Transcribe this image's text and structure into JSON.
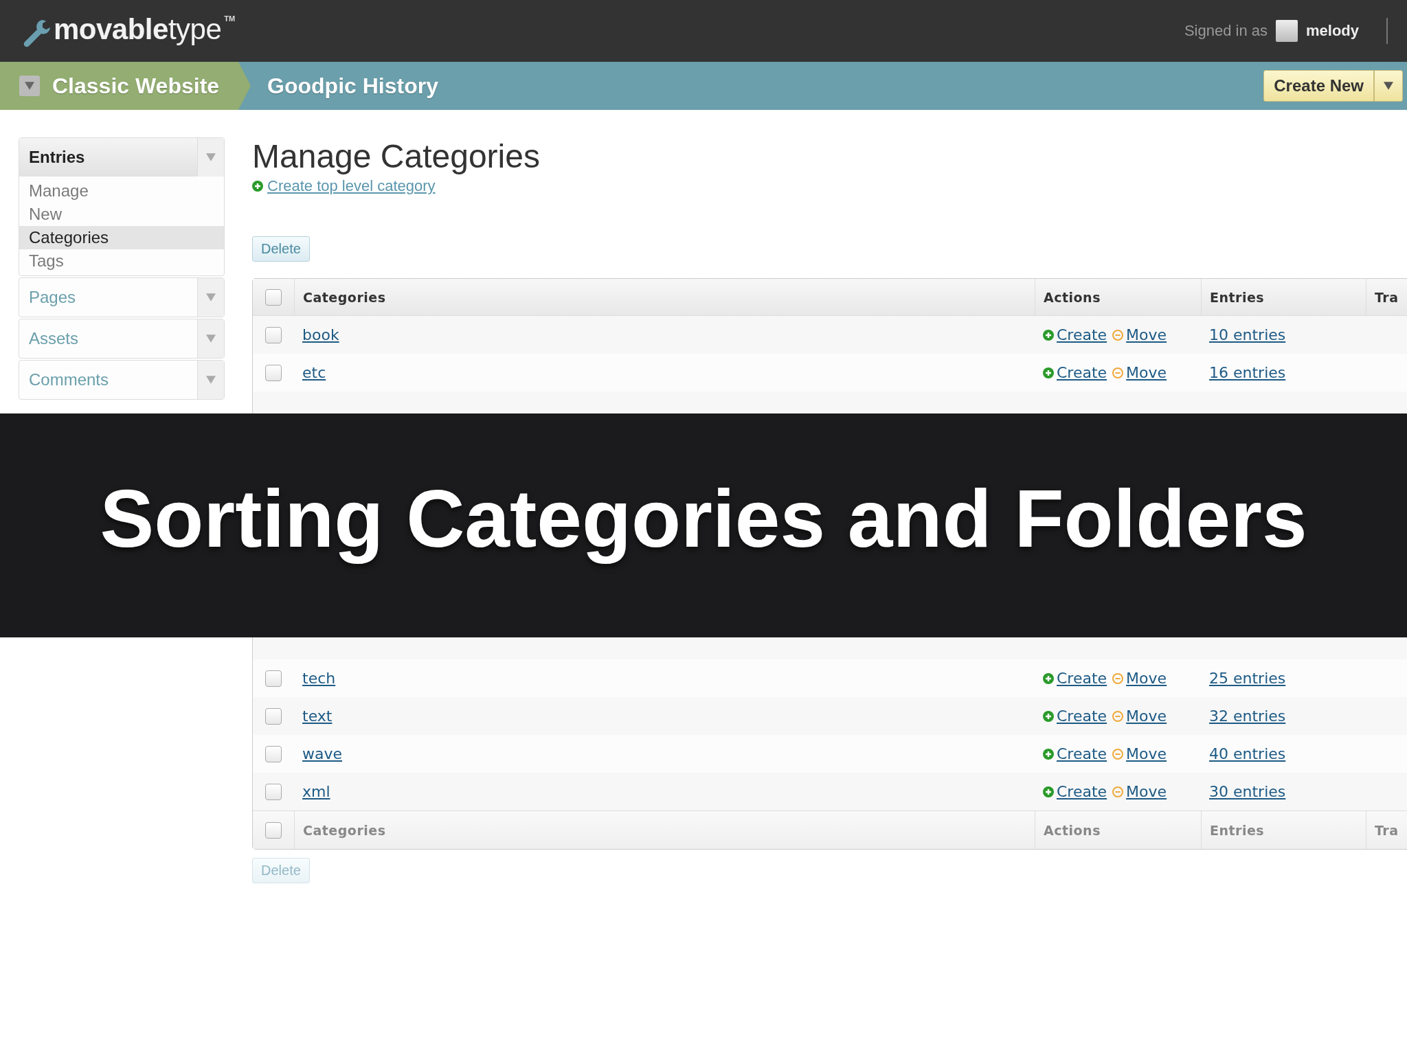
{
  "topbar": {
    "logo": "**movable**type",
    "trademark": "TM",
    "signed_in_label": "Signed in as",
    "user": "melody"
  },
  "navbar": {
    "website": "Classic Website",
    "blog": "Goodpic History",
    "create_button": "Create New"
  },
  "sidebar": {
    "menus": [
      {
        "label": "Entries",
        "expanded": true,
        "items": [
          {
            "label": "Manage",
            "selected": false
          },
          {
            "label": "New",
            "selected": false
          },
          {
            "label": "Categories",
            "selected": true
          },
          {
            "label": "Tags",
            "selected": false
          }
        ]
      },
      {
        "label": "Pages",
        "expanded": false
      },
      {
        "label": "Assets",
        "expanded": false
      },
      {
        "label": "Comments",
        "expanded": false
      }
    ]
  },
  "main": {
    "title": "Manage Categories",
    "create_link": "Create top level category",
    "delete_button": "Delete"
  },
  "table": {
    "select_all": {
      "checked": false
    },
    "columns": [
      "Categories",
      "Actions",
      "Entries",
      "Tra"
    ],
    "rows": [
      {
        "name": "book",
        "create": "Create",
        "move": "Move",
        "entries": "10 entries",
        "checked": false
      },
      {
        "name": "etc",
        "create": "Create",
        "move": "Move",
        "entries": "16 entries",
        "checked": false
      }
    ]
  },
  "banner": {
    "title": "Sorting Categories and Folders"
  },
  "table_continued": {
    "rows": [
      {
        "name": "tech",
        "create": "Create",
        "move": "Move",
        "entries": "25 entries",
        "checked": false
      },
      {
        "name": "text",
        "create": "Create",
        "move": "Move",
        "entries": "32 entries",
        "checked": false
      },
      {
        "name": "wave",
        "create": "Create",
        "move": "Move",
        "entries": "40 entries",
        "checked": false
      },
      {
        "name": "xml",
        "create": "Create",
        "move": "Move",
        "entries": "30 entries",
        "checked": false
      }
    ],
    "select_all": {
      "checked": false
    },
    "footer_columns": [
      "Categories",
      "Actions",
      "Entries",
      "Tra"
    ],
    "delete_button": "Delete"
  }
}
